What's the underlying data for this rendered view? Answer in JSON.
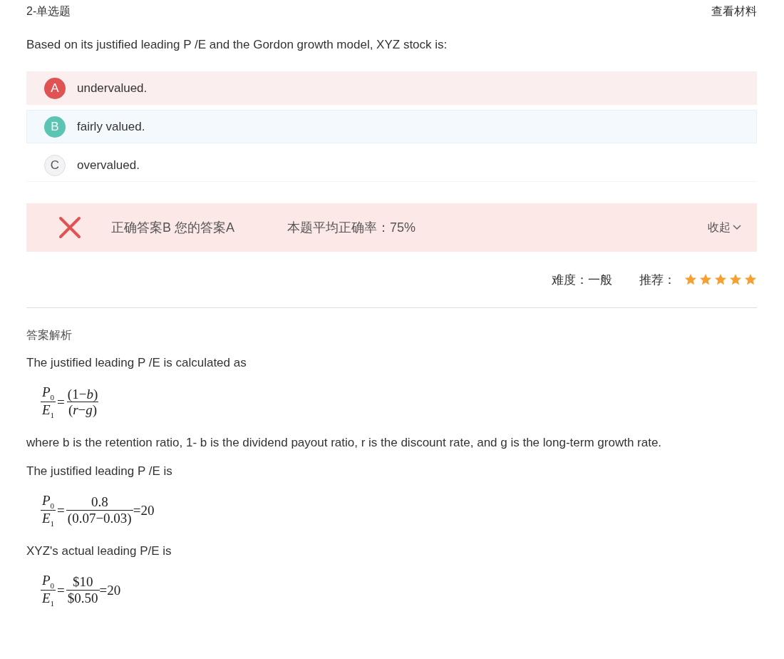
{
  "header": {
    "question_type": "2-单选题",
    "material_link": "查看材料"
  },
  "question": "Based on its justified leading P /E and the Gordon growth model, XYZ stock is:",
  "options": [
    {
      "letter": "A",
      "text": "undervalued.",
      "selected": true,
      "correct": false
    },
    {
      "letter": "B",
      "text": "fairly valued.",
      "selected": false,
      "correct": true
    },
    {
      "letter": "C",
      "text": "overvalued.",
      "selected": false,
      "correct": false
    }
  ],
  "result": {
    "correct": false,
    "answer_text": "正确答案B 您的答案A",
    "accuracy": "本题平均正确率：75%",
    "toggle": "收起"
  },
  "meta": {
    "difficulty": "难度：一般",
    "recommend_label": "推荐：",
    "stars": 5
  },
  "analysis": {
    "heading": "答案解析",
    "blocks": [
      {
        "kind": "text",
        "text": "The justified leading P /E is calculated as"
      },
      {
        "kind": "formula",
        "lhs_num": "P$_{0}$",
        "lhs_den": "E$_{1}$",
        "eq": "=",
        "rhs_num": "(1−*b*)",
        "rhs_den": "(*r*−*g*)"
      },
      {
        "kind": "text",
        "text": "where b is the retention ratio, 1- b is the dividend payout ratio, r is the discount rate, and g is the long-term growth rate."
      },
      {
        "kind": "text",
        "text": "The justified leading P /E is"
      },
      {
        "kind": "formula",
        "lhs_num": "P$_{0}$",
        "lhs_den": "E$_{1}$",
        "eq": "=",
        "rhs_num": "0.8",
        "rhs_den": "(0.07−0.03)",
        "result": "=20"
      },
      {
        "kind": "text",
        "text": "XYZ's actual leading P/E is"
      },
      {
        "kind": "formula",
        "lhs_num": "P$_{0}$",
        "lhs_den": "E$_{1}$",
        "eq": "=",
        "rhs_num": "$10",
        "rhs_den": "$0.50",
        "result": "=20"
      }
    ]
  }
}
